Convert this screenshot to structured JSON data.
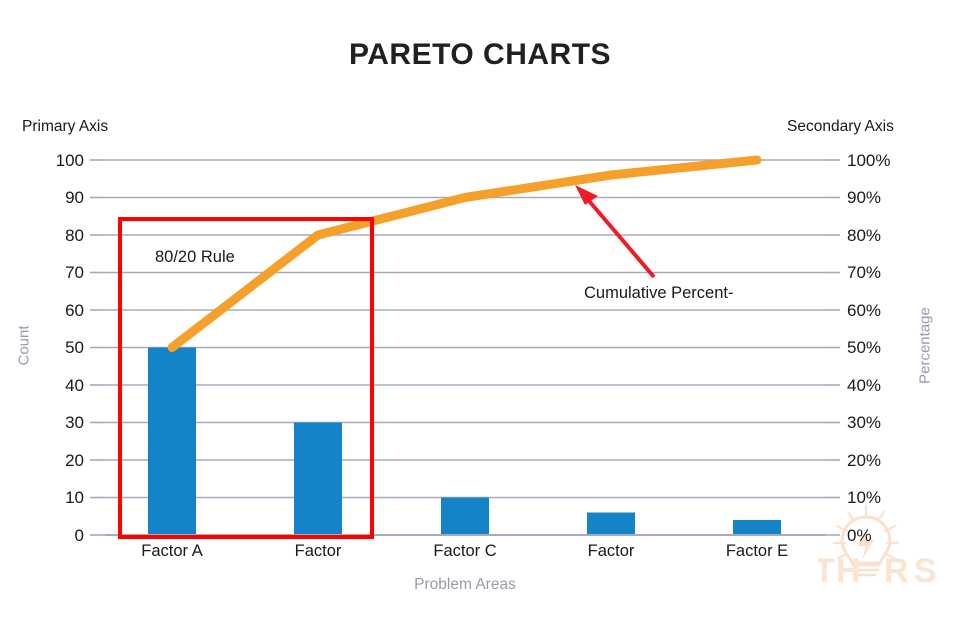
{
  "title": "PARETO CHARTS",
  "labels": {
    "primary_axis": "Primary Axis",
    "secondary_axis": "Secondary Axis",
    "count_axis": "Count",
    "percentage_axis": "Percentage",
    "x_axis_title": "Problem Areas",
    "rule_box": "80/20 Rule",
    "callout": "Cumulative Percent-"
  },
  "watermark": {
    "text": "THORS",
    "color": "#fbe0cb",
    "icon": "lightbulb-bolt-icon"
  },
  "colors": {
    "bar": "#1583c7",
    "line": "#f5a02a",
    "highlight_box": "#ff0000",
    "callout_arrow": "#ee1c25",
    "grid": "#a9a9bd",
    "axis_label": "#1a1a1a",
    "muted_label": "#9a9aad",
    "title": "#231f20"
  },
  "chart_data": {
    "type": "bar",
    "title": "PARETO CHARTS",
    "xlabel": "Problem Areas",
    "ylabel": "Count",
    "y2label": "Percentage",
    "categories": [
      "Factor A",
      "Factor",
      "Factor C",
      "Factor",
      "Factor E"
    ],
    "values": [
      50,
      30,
      10,
      6,
      4
    ],
    "ylim": [
      0,
      100
    ],
    "yticks": [
      0,
      10,
      20,
      30,
      40,
      50,
      60,
      70,
      80,
      90,
      100
    ],
    "ytick_labels": [
      "0",
      "10",
      "20",
      "30",
      "40",
      "50",
      "60",
      "70",
      "80",
      "90",
      "100"
    ],
    "y2lim": [
      0,
      100
    ],
    "y2ticks": [
      0,
      10,
      20,
      30,
      40,
      50,
      60,
      70,
      80,
      90,
      100
    ],
    "y2tick_labels": [
      "0%",
      "10%",
      "20%",
      "30%",
      "40%",
      "50%",
      "60%",
      "70%",
      "80%",
      "90%",
      "100%"
    ],
    "grid": true,
    "legend": false,
    "series": [
      {
        "name": "Count",
        "type": "bar",
        "axis": "primary",
        "values": [
          50,
          30,
          10,
          6,
          4
        ],
        "color": "#1583c7"
      },
      {
        "name": "Cumulative Percent",
        "type": "line",
        "axis": "secondary",
        "values": [
          50,
          80,
          90,
          96,
          100
        ],
        "color": "#f5a02a"
      }
    ],
    "annotations": [
      {
        "name": "80/20 Rule highlight box",
        "text": "80/20 Rule",
        "covers_categories": [
          "Factor A",
          "Factor"
        ],
        "color": "#ff0000"
      },
      {
        "name": "Cumulative percent arrow callout",
        "text": "Cumulative Percent-",
        "points_to_category": "Factor C",
        "color": "#ee1c25"
      }
    ]
  }
}
